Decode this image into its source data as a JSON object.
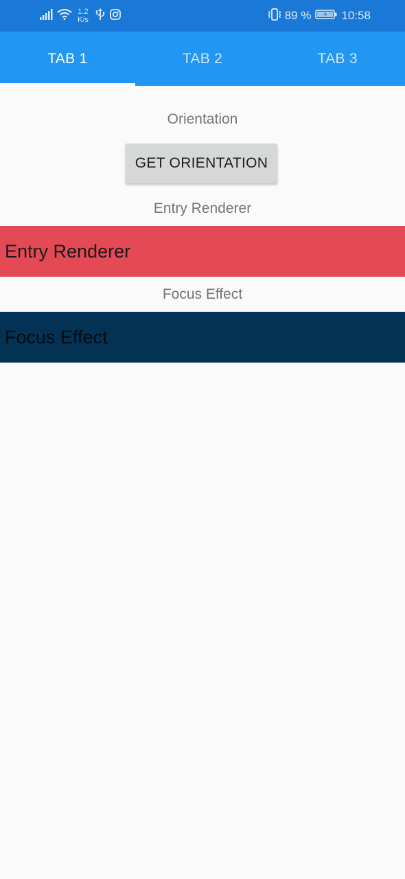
{
  "statusbar": {
    "speed_value": "1.2",
    "speed_unit": "K/s",
    "battery": "89 %",
    "time": "10:58",
    "icons": [
      "signal-icon",
      "wifi-icon",
      "usb-icon",
      "instagram-icon",
      "vibrate-icon",
      "battery-icon"
    ]
  },
  "tabs": [
    {
      "label": "TAB 1",
      "active": true
    },
    {
      "label": "TAB 2",
      "active": false
    },
    {
      "label": "TAB 3",
      "active": false
    }
  ],
  "content": {
    "orientation_label": "Orientation",
    "get_orientation_button": "GET ORIENTATION",
    "entry_renderer_label": "Entry Renderer",
    "entry_renderer_value": "Entry Renderer",
    "focus_effect_label": "Focus Effect",
    "focus_effect_value": "Focus Effect"
  },
  "colors": {
    "statusbar": "#1a78d6",
    "tabbar": "#2196f3",
    "entry_renderer_bg": "#e44a55",
    "focus_effect_bg": "#043255",
    "background": "#fafafa"
  }
}
